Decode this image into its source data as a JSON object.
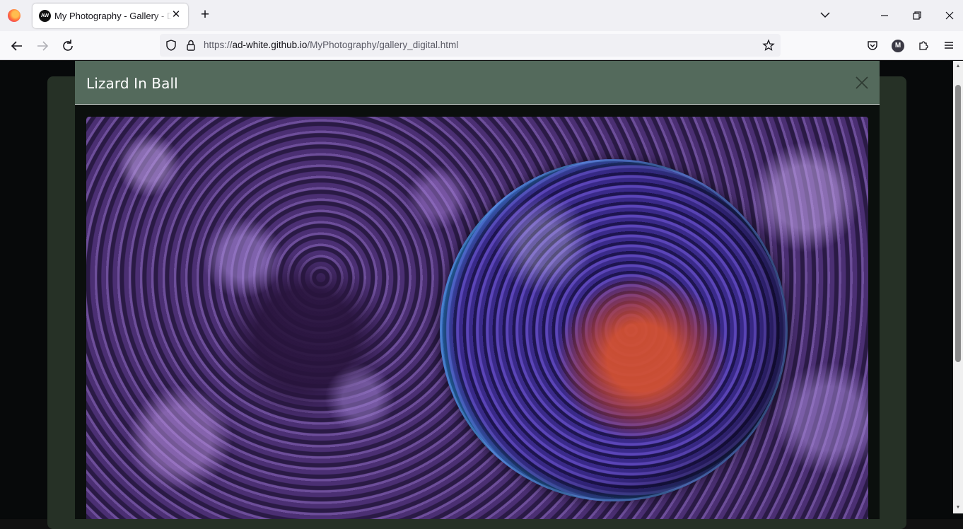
{
  "browser": {
    "tab": {
      "favicon_text": "AW",
      "title": "My Photography - Gallery - Digital"
    },
    "address_bar": {
      "url_scheme": "https://",
      "url_host": "ad-white.github.io",
      "url_path": "/MyPhotography/gallery_digital.html"
    },
    "account_initial": "M"
  },
  "modal": {
    "title": "Lizard In Ball",
    "close_label": "×"
  },
  "colors": {
    "modal_header": "#546a5c",
    "page_card": "#263126",
    "page_background": "#07090a"
  }
}
